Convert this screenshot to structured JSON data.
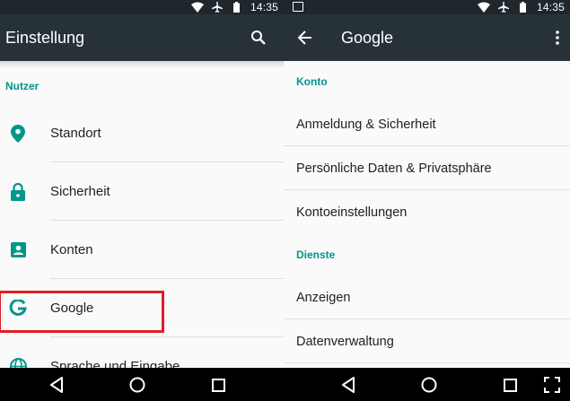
{
  "status_bar": {
    "time": "14:35"
  },
  "left": {
    "toolbar": {
      "title": "Einstellung"
    },
    "section": "Nutzer",
    "items": [
      {
        "label": "Standort",
        "icon": "location-pin-icon"
      },
      {
        "label": "Sicherheit",
        "icon": "lock-icon"
      },
      {
        "label": "Konten",
        "icon": "account-box-icon"
      },
      {
        "label": "Google",
        "icon": "google-g-icon"
      },
      {
        "label": "Sprache und Eingabe",
        "icon": "globe-icon"
      }
    ]
  },
  "right": {
    "toolbar": {
      "title": "Google"
    },
    "sections": [
      {
        "header": "Konto",
        "items": [
          "Anmeldung & Sicherheit",
          "Persönliche Daten & Privatsphäre",
          "Kontoeinstellungen"
        ]
      },
      {
        "header": "Dienste",
        "items": [
          "Anzeigen",
          "Datenverwaltung"
        ]
      }
    ]
  },
  "colors": {
    "accent": "#009688",
    "toolbar": "#263238",
    "status_bar": "#1f272c",
    "highlight": "#e01e24"
  }
}
